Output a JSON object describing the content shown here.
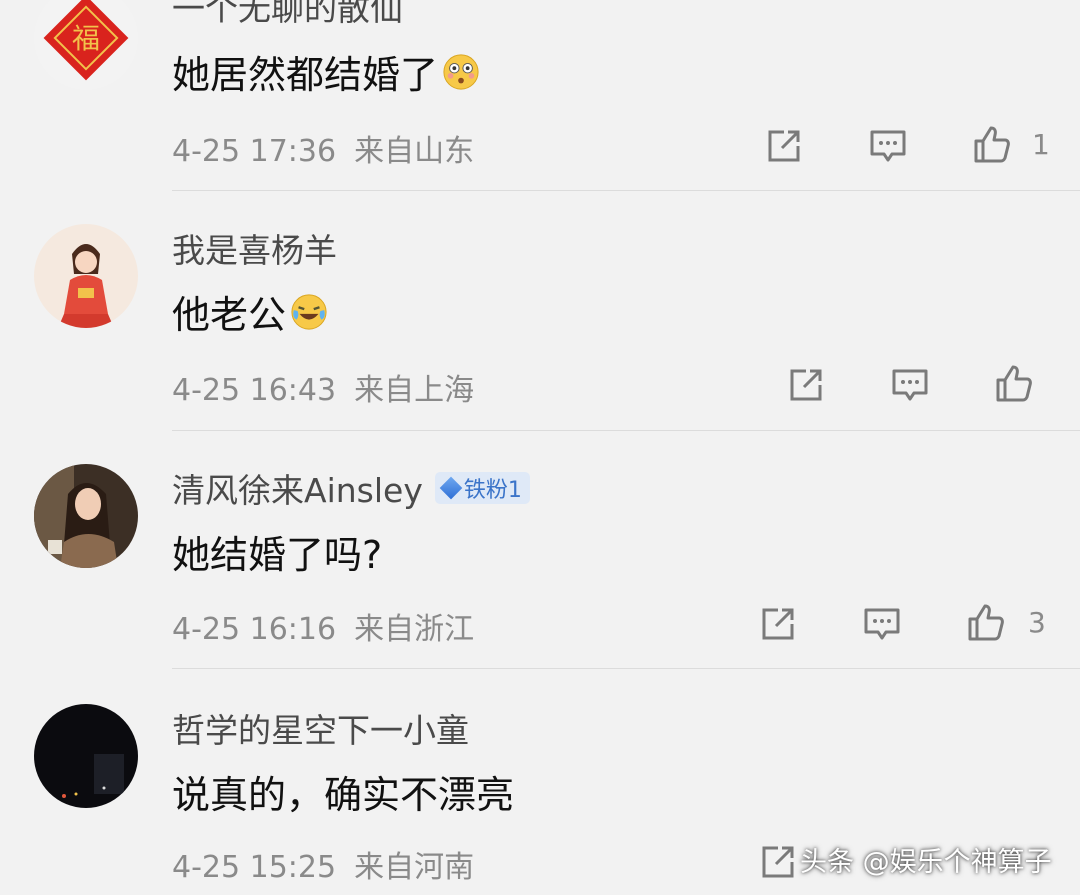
{
  "comments": [
    {
      "username": "一个无聊的散仙",
      "content": "她居然都结婚了",
      "emoji": "flushed-emoji",
      "time": "4-25 17:36",
      "location": "来自山东",
      "likes": "1"
    },
    {
      "username": "我是喜杨羊",
      "content": "他老公",
      "emoji": "laughing-tears-emoji",
      "time": "4-25 16:43",
      "location": "来自上海",
      "likes": ""
    },
    {
      "username": "清风徐来Ainsley",
      "badge": "铁粉1",
      "content": "她结婚了吗?",
      "time": "4-25 16:16",
      "location": "来自浙江",
      "likes": "3"
    },
    {
      "username": "哲学的星空下一小童",
      "content": "说真的，确实不漂亮",
      "time": "4-25 15:25",
      "location": "来自河南",
      "likes": ""
    }
  ],
  "watermark": "头条 @娱乐个神算子",
  "colors": {
    "background": "#f2f2f2",
    "meta": "#8a8a8a",
    "badge": "#3b74c9"
  }
}
